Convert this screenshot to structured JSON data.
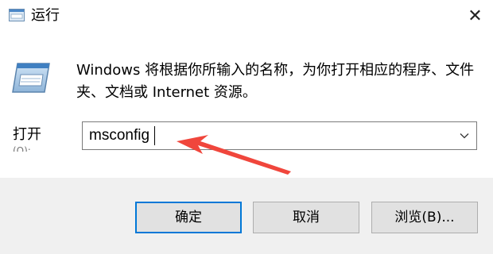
{
  "window": {
    "title": "运行",
    "close_glyph": "✕"
  },
  "description": "Windows 将根据你所输入的名称，为你打开相应的程序、文件夹、文档或 Internet 资源。",
  "open_field": {
    "label": "打开",
    "value": "msconfig"
  },
  "buttons": {
    "ok": "确定",
    "cancel": "取消",
    "browse": "浏览(B)..."
  },
  "icons": {
    "app": "run-dialog-icon",
    "run": "run-program-icon",
    "dropdown": "chevron-down-icon",
    "close": "close-icon"
  },
  "colors": {
    "accent": "#0078d7",
    "annotation_arrow": "#f0463c",
    "footer_bg": "#f0f0f0"
  }
}
